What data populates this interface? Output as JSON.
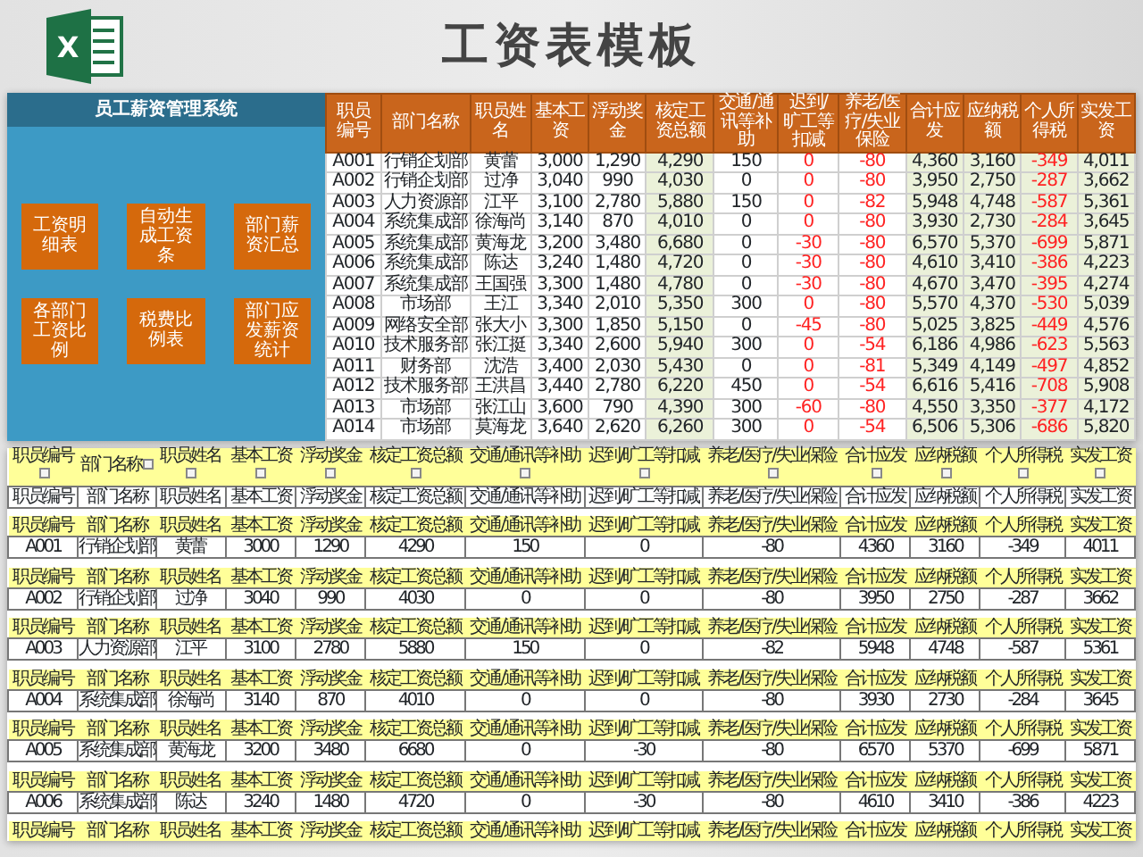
{
  "header": {
    "logo_text": "X",
    "title": "工资表模板"
  },
  "panel": {
    "title": "员工薪资管理系统",
    "buttons": [
      "工资明细表",
      "自动生成工资条",
      "部门薪资汇总",
      "各部门工资比例",
      "税费比例表",
      "部门应发薪资统计"
    ]
  },
  "salary_table": {
    "columns": [
      {
        "label": "职员编号",
        "shade": false,
        "kind": "plain"
      },
      {
        "label": "部门名称",
        "shade": false,
        "kind": "plain"
      },
      {
        "label": "职员姓名",
        "shade": false,
        "kind": "plain"
      },
      {
        "label": "基本工资",
        "shade": false,
        "kind": "plain"
      },
      {
        "label": "浮动奖金",
        "shade": false,
        "kind": "plain"
      },
      {
        "label": "核定工资总额",
        "shade": true,
        "kind": "plain"
      },
      {
        "label": "交通/通讯等补助",
        "shade": false,
        "kind": "plain"
      },
      {
        "label": "迟到/旷工等扣减",
        "shade": false,
        "kind": "deduction"
      },
      {
        "label": "养老/医疗/失业保险",
        "shade": false,
        "kind": "deduction"
      },
      {
        "label": "合计应发",
        "shade": true,
        "kind": "plain"
      },
      {
        "label": "应纳税额",
        "shade": true,
        "kind": "plain"
      },
      {
        "label": "个人所得税",
        "shade": true,
        "kind": "deduction"
      },
      {
        "label": "实发工资",
        "shade": true,
        "kind": "plain"
      }
    ],
    "rows": [
      [
        "A001",
        "行销企划部",
        "黄蕾",
        "3,000",
        "1,290",
        "4,290",
        "150",
        "0",
        "-80",
        "4,360",
        "3,160",
        "-349",
        "4,011"
      ],
      [
        "A002",
        "行销企划部",
        "过净",
        "3,040",
        "990",
        "4,030",
        "0",
        "0",
        "-80",
        "3,950",
        "2,750",
        "-287",
        "3,662"
      ],
      [
        "A003",
        "人力资源部",
        "江平",
        "3,100",
        "2,780",
        "5,880",
        "150",
        "0",
        "-82",
        "5,948",
        "4,748",
        "-587",
        "5,361"
      ],
      [
        "A004",
        "系统集成部",
        "徐海尚",
        "3,140",
        "870",
        "4,010",
        "0",
        "0",
        "-80",
        "3,930",
        "2,730",
        "-284",
        "3,645"
      ],
      [
        "A005",
        "系统集成部",
        "黄海龙",
        "3,200",
        "3,480",
        "6,680",
        "0",
        "-30",
        "-80",
        "6,570",
        "5,370",
        "-699",
        "5,871"
      ],
      [
        "A006",
        "系统集成部",
        "陈达",
        "3,240",
        "1,480",
        "4,720",
        "0",
        "-30",
        "-80",
        "4,610",
        "3,410",
        "-386",
        "4,223"
      ],
      [
        "A007",
        "系统集成部",
        "王国强",
        "3,300",
        "1,480",
        "4,780",
        "0",
        "-30",
        "-80",
        "4,670",
        "3,470",
        "-395",
        "4,274"
      ],
      [
        "A008",
        "市场部",
        "王江",
        "3,340",
        "2,010",
        "5,350",
        "300",
        "0",
        "-80",
        "5,570",
        "4,370",
        "-530",
        "5,039"
      ],
      [
        "A009",
        "网络安全部",
        "张大小",
        "3,300",
        "1,850",
        "5,150",
        "0",
        "-45",
        "-80",
        "5,025",
        "3,825",
        "-449",
        "4,576"
      ],
      [
        "A010",
        "技术服务部",
        "张江挺",
        "3,340",
        "2,600",
        "5,940",
        "300",
        "0",
        "-54",
        "6,186",
        "4,986",
        "-623",
        "5,563"
      ],
      [
        "A011",
        "财务部",
        "沈浩",
        "3,400",
        "2,030",
        "5,430",
        "0",
        "0",
        "-81",
        "5,349",
        "4,149",
        "-497",
        "4,852"
      ],
      [
        "A012",
        "技术服务部",
        "王洪昌",
        "3,440",
        "2,780",
        "6,220",
        "450",
        "0",
        "-54",
        "6,616",
        "5,416",
        "-708",
        "5,908"
      ],
      [
        "A013",
        "市场部",
        "张江山",
        "3,600",
        "790",
        "4,390",
        "300",
        "-60",
        "-80",
        "4,550",
        "3,350",
        "-377",
        "4,172"
      ],
      [
        "A014",
        "市场部",
        "莫海龙",
        "3,640",
        "2,620",
        "6,260",
        "300",
        "0",
        "-54",
        "6,506",
        "5,306",
        "-686",
        "5,820"
      ]
    ]
  },
  "slip_sheet": {
    "filter_row": [
      "职员编号",
      "部门名称",
      "职员姓名",
      "基本工资",
      "浮动奖金",
      "核定工资总额",
      "交通/通讯等补助",
      "迟到/旷工等扣减",
      "养老/医疗/失业保险",
      "合计应发",
      "应纳税额",
      "个人所得税",
      "实发工资"
    ],
    "header_row": [
      "职员编号",
      "部门名称",
      "职员姓名",
      "基本工资",
      "浮动奖金",
      "核定工资总额",
      "交通/通讯等补助",
      "迟到/旷工等扣减",
      "养老/医疗/失业保险",
      "合计应发",
      "应纳税额",
      "个人所得税",
      "实发工资"
    ],
    "slips": [
      {
        "header": [
          "职员编号",
          "部门名称",
          "职员姓名",
          "基本工资",
          "浮动奖金",
          "核定工资总额",
          "交通/通讯等补助",
          "迟到/旷工等扣减",
          "养老/医疗/失业保险",
          "合计应发",
          "应纳税额",
          "个人所得税",
          "实发工资"
        ],
        "cells": [
          "A001",
          "行销企划部",
          "黄蕾",
          "3000",
          "1290",
          "4290",
          "150",
          "0",
          "-80",
          "4360",
          "3160",
          "-349",
          "4011"
        ]
      },
      {
        "header": [
          "职员编号",
          "部门名称",
          "职员姓名",
          "基本工资",
          "浮动奖金",
          "核定工资总额",
          "交通/通讯等补助",
          "迟到/旷工等扣减",
          "养老/医疗/失业保险",
          "合计应发",
          "应纳税额",
          "个人所得税",
          "实发工资"
        ],
        "cells": [
          "A002",
          "行销企划部",
          "过净",
          "3040",
          "990",
          "4030",
          "0",
          "0",
          "-80",
          "3950",
          "2750",
          "-287",
          "3662"
        ]
      },
      {
        "header": [
          "职员编号",
          "部门名称",
          "职员姓名",
          "基本工资",
          "浮动奖金",
          "核定工资总额",
          "交通/通讯等补助",
          "迟到/旷工等扣减",
          "养老/医疗/失业保险",
          "合计应发",
          "应纳税额",
          "个人所得税",
          "实发工资"
        ],
        "cells": [
          "A003",
          "人力资源部",
          "江平",
          "3100",
          "2780",
          "5880",
          "150",
          "0",
          "-82",
          "5948",
          "4748",
          "-587",
          "5361"
        ]
      },
      {
        "header": [
          "职员编号",
          "部门名称",
          "职员姓名",
          "基本工资",
          "浮动奖金",
          "核定工资总额",
          "交通/通讯等补助",
          "迟到/旷工等扣减",
          "养老/医疗/失业保险",
          "合计应发",
          "应纳税额",
          "个人所得税",
          "实发工资"
        ],
        "cells": [
          "A004",
          "系统集成部",
          "徐海尚",
          "3140",
          "870",
          "4010",
          "0",
          "0",
          "-80",
          "3930",
          "2730",
          "-284",
          "3645"
        ]
      },
      {
        "header": [
          "职员编号",
          "部门名称",
          "职员姓名",
          "基本工资",
          "浮动奖金",
          "核定工资总额",
          "交通/通讯等补助",
          "迟到/旷工等扣减",
          "养老/医疗/失业保险",
          "合计应发",
          "应纳税额",
          "个人所得税",
          "实发工资"
        ],
        "cells": [
          "A005",
          "系统集成部",
          "黄海龙",
          "3200",
          "3480",
          "6680",
          "0",
          "-30",
          "-80",
          "6570",
          "5370",
          "-699",
          "5871"
        ]
      },
      {
        "header": [
          "职员编号",
          "部门名称",
          "职员姓名",
          "基本工资",
          "浮动奖金",
          "核定工资总额",
          "交通/通讯等补助",
          "迟到/旷工等扣减",
          "养老/医疗/失业保险",
          "合计应发",
          "应纳税额",
          "个人所得税",
          "实发工资"
        ],
        "cells": [
          "A006",
          "系统集成部",
          "陈达",
          "3240",
          "1480",
          "4720",
          "0",
          "-30",
          "-80",
          "4610",
          "3410",
          "-386",
          "4223"
        ]
      }
    ],
    "trailing_header": [
      "职员编号",
      "部门名称",
      "职员姓名",
      "基本工资",
      "浮动奖金",
      "核定工资总额",
      "交通/通讯等补助",
      "迟到/旷工等扣减",
      "养老/医疗/失业保险",
      "合计应发",
      "应纳税额",
      "个人所得税",
      "实发工资"
    ]
  }
}
